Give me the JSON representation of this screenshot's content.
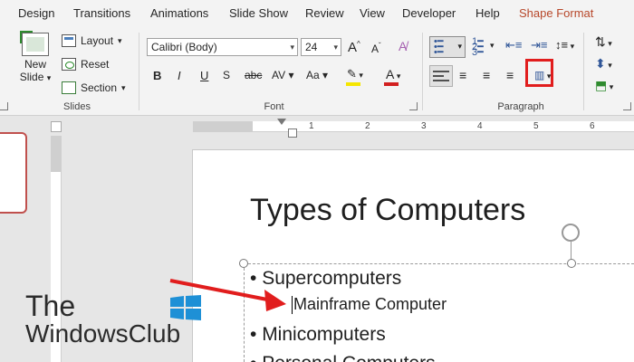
{
  "tabs": [
    "Design",
    "Transitions",
    "Animations",
    "Slide Show",
    "Review",
    "View",
    "Developer",
    "Help",
    "Shape Format"
  ],
  "slides_group": {
    "new_slide_line1": "New",
    "new_slide_line2": "Slide",
    "layout": "Layout",
    "reset": "Reset",
    "section": "Section",
    "label": "Slides"
  },
  "font_group": {
    "font_name": "Calibri (Body)",
    "font_size": "24",
    "grow": "A",
    "shrink": "A",
    "bold": "B",
    "italic": "I",
    "underline": "U",
    "strike": "S",
    "spacing": "AV",
    "case": "Aa",
    "font_color": "A",
    "label": "Font"
  },
  "paragraph_group": {
    "label": "Paragraph",
    "highlighted_button": "increase-indent"
  },
  "ruler": {
    "numbers": [
      "1",
      "2",
      "3",
      "4",
      "5",
      "6"
    ]
  },
  "slide": {
    "title": "Types of Computers",
    "bullets": [
      {
        "text": "Supercomputers",
        "level": 1
      },
      {
        "text": "Mainframe Computer",
        "level": 2
      },
      {
        "text": "Minicomputers",
        "level": 1
      },
      {
        "text": "Personal Computers",
        "level": 1
      }
    ]
  },
  "watermark": {
    "line1": "The",
    "line2": "WindowsClub"
  },
  "colors": {
    "accent_tab": "#b7472a",
    "highlight": "#e11d1d",
    "arrow": "#e11d1d",
    "font_color_bar": "#d21f1f",
    "highlight_bar": "#f5e600"
  }
}
